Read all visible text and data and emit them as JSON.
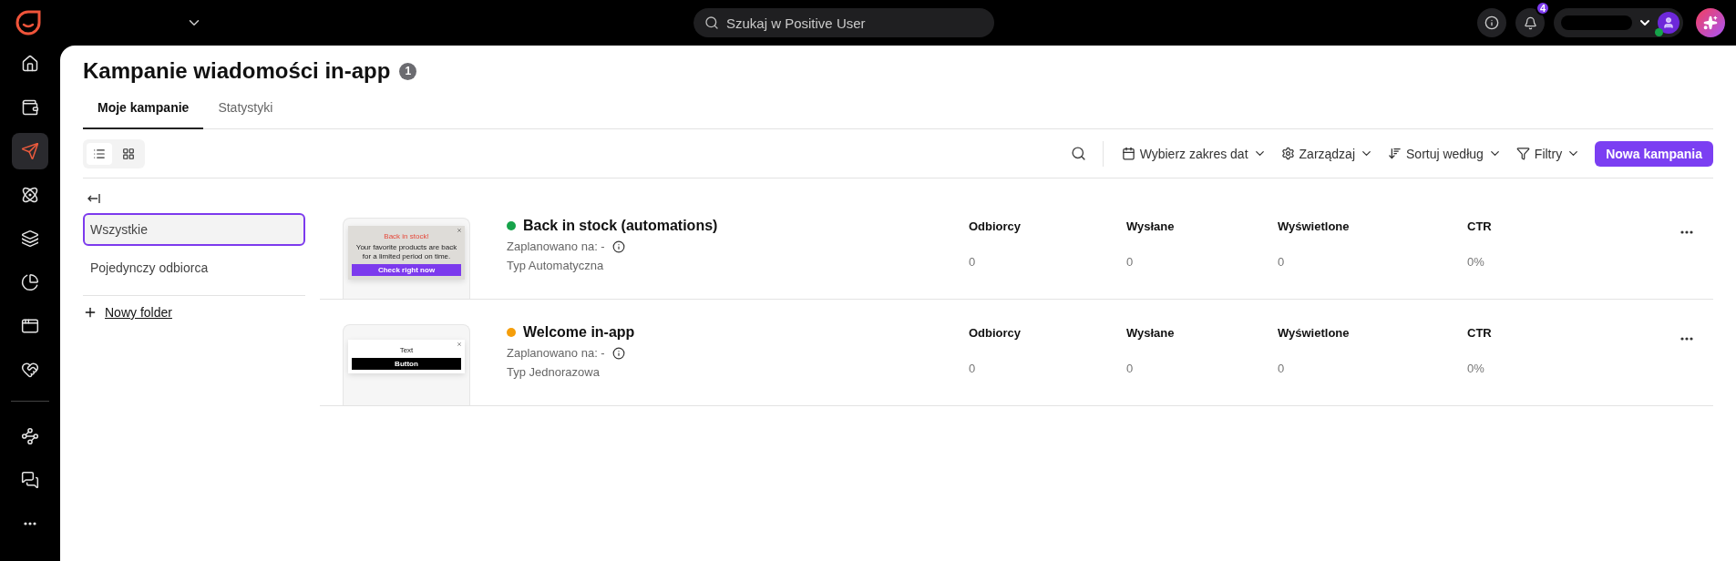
{
  "topbar": {
    "search": {
      "placeholder": "Szukaj w Positive User"
    },
    "notifications_badge": "4"
  },
  "nav": {
    "items": [
      {
        "selected": false
      },
      {
        "selected": false
      },
      {
        "selected": true
      },
      {
        "selected": false
      },
      {
        "selected": false
      },
      {
        "selected": false
      },
      {
        "selected": false
      },
      {
        "selected": false
      }
    ],
    "bottom_items": [
      {
        "selected": false
      },
      {
        "selected": false
      },
      {
        "selected": false
      }
    ]
  },
  "page": {
    "title": "Kampanie wiadomości in-app",
    "count": "1",
    "tabs": [
      {
        "label": "Moje kampanie",
        "selected": true
      },
      {
        "label": "Statystyki",
        "selected": false
      }
    ],
    "view_toggle": [
      {
        "selected": true
      },
      {
        "selected": false
      }
    ],
    "toolbar": [
      "Wybierz zakres dat",
      "Zarządzaj",
      "Sortuj według",
      "Filtry"
    ],
    "primary_button": "Nowa kampania"
  },
  "folders": {
    "items": [
      {
        "label": "Wszystkie",
        "selected": true
      },
      {
        "label": "Pojedynczy odbiorca",
        "selected": false
      }
    ],
    "new_folder": "Nowy folder"
  },
  "campaigns": [
    {
      "name": "Back in stock (automations)",
      "color": "#16a34a",
      "scheduled": "Zaplanowano na: -",
      "type": "Typ Automatyczna",
      "preview": {
        "kind": "promo",
        "title": "Back in stock!",
        "text": "Your favorite products are back for a limited period on time.",
        "button": "Check right now"
      },
      "stats": [
        {
          "label": "Odbiorcy",
          "value": "0"
        },
        {
          "label": "Wysłane",
          "value": "0"
        },
        {
          "label": "Wyświetlone",
          "value": "0"
        },
        {
          "label": "CTR",
          "value": "0%"
        }
      ]
    },
    {
      "name": "Welcome in-app",
      "color": "#f59e0b",
      "scheduled": "Zaplanowano na: -",
      "type": "Typ Jednorazowa",
      "preview": {
        "kind": "simple",
        "text": "Text",
        "button": "Button"
      },
      "stats": [
        {
          "label": "Odbiorcy",
          "value": "0"
        },
        {
          "label": "Wysłane",
          "value": "0"
        },
        {
          "label": "Wyświetlone",
          "value": "0"
        },
        {
          "label": "CTR",
          "value": "0%"
        }
      ]
    }
  ]
}
